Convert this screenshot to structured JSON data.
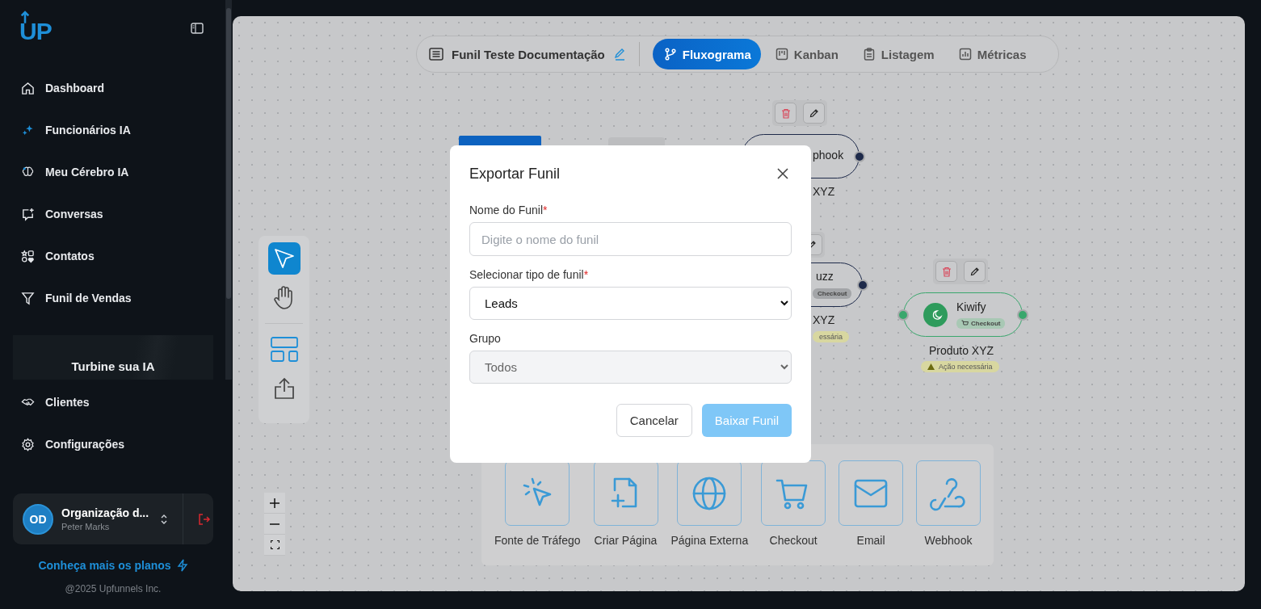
{
  "sidebar": {
    "logo": "UP",
    "menu": [
      {
        "kind": "home",
        "label": "Dashboard"
      },
      {
        "kind": "sparkles",
        "label": "Funcionários IA"
      },
      {
        "kind": "brain",
        "label": "Meu Cérebro IA"
      },
      {
        "kind": "chat",
        "label": "Conversas"
      },
      {
        "kind": "contacts",
        "label": "Contatos"
      },
      {
        "kind": "funnel",
        "label": "Funil de Vendas"
      }
    ],
    "promo": {
      "title": "Turbine sua IA"
    },
    "bottom_menu": [
      {
        "kind": "handshake",
        "label": "Clientes"
      },
      {
        "kind": "gear",
        "label": "Configurações"
      }
    ],
    "account": {
      "initials": "OD",
      "name": "Organização d...",
      "subtitle": "Peter Marks"
    },
    "plans_link": "Conheça mais os planos",
    "footer": "@2025 Upfunnels Inc."
  },
  "toolbar": {
    "funnel_name": "Funil Teste Documentação",
    "views": [
      {
        "kind": "flow",
        "label": "Fluxograma",
        "selected": true
      },
      {
        "kind": "kanban",
        "label": "Kanban",
        "selected": false
      },
      {
        "kind": "list",
        "label": "Listagem",
        "selected": false
      },
      {
        "kind": "metrics",
        "label": "Métricas",
        "selected": false
      }
    ]
  },
  "tools": [
    {
      "kind": "pointer",
      "selected": true
    },
    {
      "kind": "hand",
      "selected": false
    }
  ],
  "nodes": [
    {
      "title": "phook",
      "label": "XYZ",
      "color": "#1e2a4a"
    },
    {
      "title": "uzz",
      "badge": "Checkout",
      "label": "XYZ",
      "status": "essária",
      "color": "#1e2a4a"
    },
    {
      "title": "Kiwify",
      "badge": "Checkout",
      "label": "Produto XYZ",
      "status": "Ação necessária",
      "color": "#3aa76d"
    }
  ],
  "palette": [
    {
      "kind": "traffic",
      "label": "Fonte de Tráfego"
    },
    {
      "kind": "page",
      "label": "Criar Página"
    },
    {
      "kind": "globe",
      "label": "Página Externa"
    },
    {
      "kind": "cart",
      "label": "Checkout"
    },
    {
      "kind": "mail",
      "label": "Email"
    },
    {
      "kind": "webhook",
      "label": "Webhook"
    }
  ],
  "modal": {
    "title": "Exportar Funil",
    "fields": [
      {
        "kind": "text",
        "label": "Nome do Funil",
        "required_mark": "*",
        "placeholder": "Digite o nome do funil"
      },
      {
        "kind": "select",
        "label": "Selecionar tipo de funil",
        "required_mark": "*",
        "value": "Leads",
        "disabled": false
      },
      {
        "kind": "select",
        "label": "Grupo",
        "value": "Todos",
        "disabled": true
      }
    ],
    "buttons": [
      {
        "kind": "secondary",
        "label": "Cancelar"
      },
      {
        "kind": "primary",
        "label": "Baixar Funil",
        "disabled": true
      }
    ]
  }
}
